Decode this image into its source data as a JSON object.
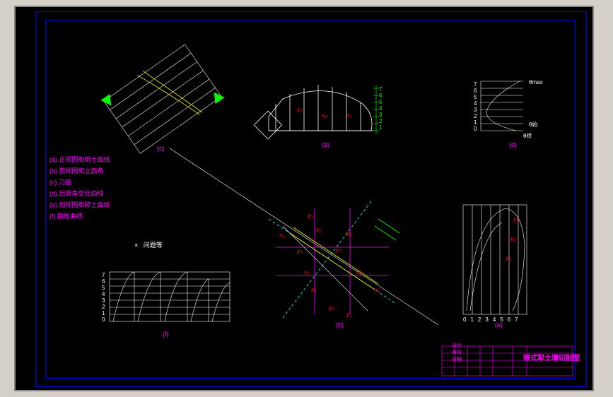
{
  "legend": {
    "a": "(a).正视图和倒土曲线",
    "b": "(b).俯视图和立面角",
    "c": "(c).刀盘",
    "d": "(d).后装角变化曲线",
    "e": "(e).侧视图和碎土曲线",
    "f": "(f).翻板曲线"
  },
  "comment_label": "问题等",
  "figure_labels": {
    "a": "(a)",
    "b": "(b)",
    "c": "(c)",
    "d": "(d)",
    "e": "(e)",
    "f": "(f)"
  },
  "coord_labels": {
    "x1": "x₁",
    "x2": "x₂",
    "x3": "x₃",
    "y1": "y₁",
    "y2": "y₂",
    "y3": "y₃"
  },
  "theta_labels": {
    "max": "θmax",
    "mid": "θ始",
    "min": "θ终"
  },
  "axis_numbers_v": [
    "7",
    "6",
    "5",
    "4",
    "3",
    "2",
    "1",
    "0"
  ],
  "axis_numbers_h": [
    "0",
    "1",
    "2",
    "3",
    "4",
    "5",
    "6",
    "7"
  ],
  "title_block": {
    "main": "铧式犁土壤切削图",
    "line1": "设计",
    "line2": "审核",
    "line3": "日期"
  }
}
